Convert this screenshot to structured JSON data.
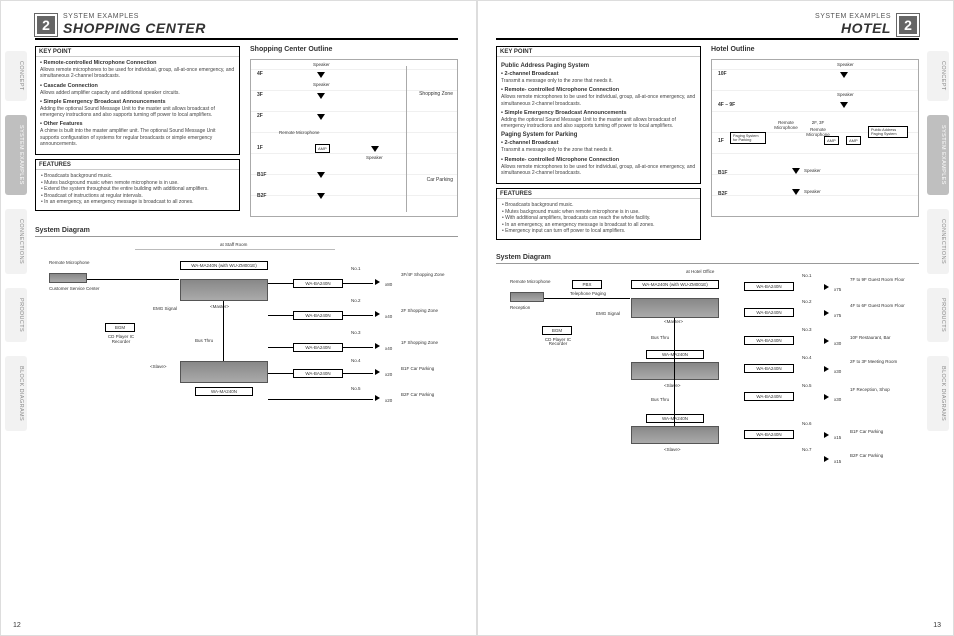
{
  "nav_tabs": [
    "CONCEPT",
    "SYSTEM EXAMPLES",
    "CONNECTIONS",
    "PRODUCTS",
    "BLOCK DIAGRAMS"
  ],
  "left": {
    "badge": "2",
    "category": "SYSTEM EXAMPLES",
    "title": "SHOPPING CENTER",
    "key_point_label": "KEY POINT",
    "key_points": [
      {
        "h": "Remote-controlled Microphone Connection",
        "d": "Allows remote microphones to be used for individual, group, all-at-once emergency, and simultaneous 2-channel broadcasts."
      },
      {
        "h": "Cascade Connection",
        "d": "Allows added amplifier capacity and additional speaker circuits."
      },
      {
        "h": "Simple Emergency Broadcast Announcements",
        "d": "Adding the optional Sound Message Unit to the master unit allows broadcast of emergency instructions and also supports turning off power to local amplifiers."
      },
      {
        "h": "Other Features",
        "d": "A chime is built into the master amplifier unit. The optional Sound Message Unit supports configuration of systems for regular broadcasts or simple emergency announcements."
      }
    ],
    "features_label": "FEATURES",
    "features": [
      "Broadcasts background music.",
      "Mutes background music when remote microphone is in use.",
      "Extend the system throughout the entire building with additional amplifiers.",
      "Broadcast of instructions at regular intervals.",
      "In an emergency, an emergency message is broadcast to all zones."
    ],
    "outline_title": "Shopping Center Outline",
    "outline": {
      "floors": [
        "4F",
        "3F",
        "2F",
        "1F",
        "B1F",
        "B2F"
      ],
      "labels": {
        "speaker": "Speaker",
        "remote_mic": "Remote Microphone",
        "amp": "AMP",
        "shopping_zone": "Shopping Zone",
        "car_parking": "Car Parking"
      }
    },
    "sysdiag_title": "System Diagram",
    "diagram": {
      "location": "at Staff Room",
      "remote_mic": "Remote Microphone",
      "customer": "Customer Service Center",
      "bgm": "BGM",
      "bgm_src": "CD Player IC Recorder",
      "emg": "EMG Signal",
      "master": "<Master>",
      "slave": "<Slave>",
      "busthru": "Bus Thru",
      "main_unit": "WA-MA240N (with WU-ZM001E)",
      "slave_unit": "WA-MA240N",
      "amp": "WA-BA240N",
      "outputs": [
        {
          "no": "No.1",
          "mult": "x80",
          "zone": "3F/4F Shopping Zone"
        },
        {
          "no": "No.2",
          "mult": "x40",
          "zone": "2F Shopping Zone"
        },
        {
          "no": "No.3",
          "mult": "x40",
          "zone": "1F Shopping Zone"
        },
        {
          "no": "No.4",
          "mult": "x20",
          "zone": "B1F Car Parking"
        },
        {
          "no": "No.5",
          "mult": "x20",
          "zone": "B2F Car Parking"
        }
      ]
    },
    "page_num": "12"
  },
  "right": {
    "badge": "2",
    "category": "SYSTEM EXAMPLES",
    "title": "HOTEL",
    "key_point_label": "KEY POINT",
    "groups": [
      {
        "title": "Public Address Paging System",
        "points": [
          {
            "h": "2-channel Broadcast",
            "d": "Transmit a message only to the zone that needs it."
          },
          {
            "h": "Remote- controlled Microphone Connection",
            "d": "Allows remote microphones to be used for individual, group, all-at-once emergency, and simultaneous 2-channel broadcasts."
          },
          {
            "h": "Simple Emergency Broadcast Announcements",
            "d": "Adding the optional Sound Message Unit to the master unit allows broadcast of emergency instructions and also supports turning off power to local amplifiers."
          }
        ]
      },
      {
        "title": "Paging System for Parking",
        "points": [
          {
            "h": "2-channel Broadcast",
            "d": "Transmit a message only to the zone that needs it."
          },
          {
            "h": "Remote- controlled Microphone Connection",
            "d": "Allows remote microphones to be used for individual, group, all-at-once emergency, and simultaneous 2-channel broadcasts."
          }
        ]
      }
    ],
    "features_label": "FEATURES",
    "features": [
      "Broadcasts background music.",
      "Mutes background music when remote microphone is in use.",
      "With additional amplifiers, broadcasts can reach the whole facility.",
      "In an emergency, an emergency message is broadcast to all zones.",
      "Emergency input can turn off power to local amplifiers."
    ],
    "outline_title": "Hotel Outline",
    "outline": {
      "floors": [
        "10F",
        "4F – 9F",
        "1F",
        "B1F",
        "B2F"
      ],
      "labels": {
        "speaker": "Speaker",
        "remote_mic": "Remote Microphone",
        "amp": "AMP",
        "paging_parking": "Paging System for Parking",
        "pa_paging": "Public Address Paging System",
        "floors23": "2F, 3F"
      }
    },
    "sysdiag_title": "System Diagram",
    "diagram": {
      "location": "at Hotel Office",
      "remote_mic": "Remote Microphone",
      "reception": "Reception",
      "pbx": "PBX",
      "tel_paging": "Telephone Paging",
      "bgm": "BGM",
      "bgm_src": "CD Player IC Recorder",
      "emg": "EMG Signal",
      "master": "<Master>",
      "slave": "<Slave>",
      "busthru": "Bus Thru",
      "main_unit": "WA-MA240N (with WU-ZM001E)",
      "slave_unit": "WA-MA240N",
      "amp": "WA-BA240N",
      "outputs": [
        {
          "no": "No.1",
          "mult": "x75",
          "zone": "7F to 9F Guest Room Floor"
        },
        {
          "no": "No.2",
          "mult": "x75",
          "zone": "4F to 6F Guest Room Floor"
        },
        {
          "no": "No.3",
          "mult": "x30",
          "zone": "10F Restaurant, Bar"
        },
        {
          "no": "No.4",
          "mult": "x30",
          "zone": "2F to 3F Meeting Room"
        },
        {
          "no": "No.5",
          "mult": "x30",
          "zone": "1F Reception, Shop"
        },
        {
          "no": "No.6",
          "mult": "x15",
          "zone": "B1F Car Parking"
        },
        {
          "no": "No.7",
          "mult": "x15",
          "zone": "B2F Car Parking"
        }
      ]
    },
    "page_num": "13"
  }
}
